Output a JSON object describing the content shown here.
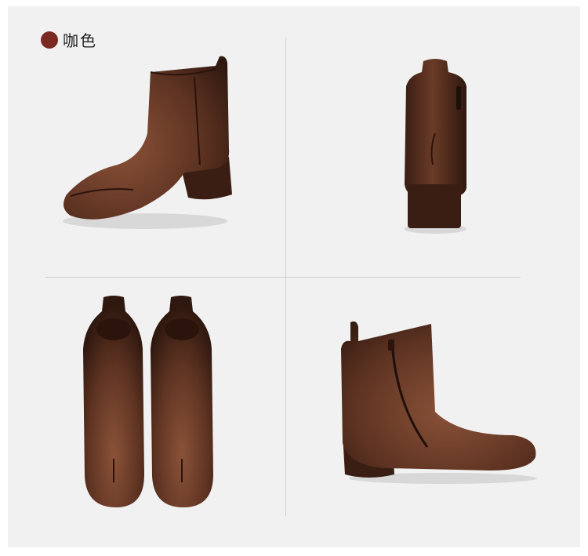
{
  "color_option": {
    "label": "咖色",
    "swatch_color": "#7a2a22"
  },
  "photos": [
    {
      "view": "side-three-quarter",
      "icon": "ankle-boot"
    },
    {
      "view": "back",
      "icon": "ankle-boot"
    },
    {
      "view": "front-pair",
      "icon": "ankle-boot-pair"
    },
    {
      "view": "inner-side-zipper",
      "icon": "ankle-boot"
    }
  ],
  "colors": {
    "leather_dark": "#3a1e14",
    "leather_mid": "#5e3322",
    "leather_light": "#8a5238",
    "background": "#f1f1f1"
  }
}
